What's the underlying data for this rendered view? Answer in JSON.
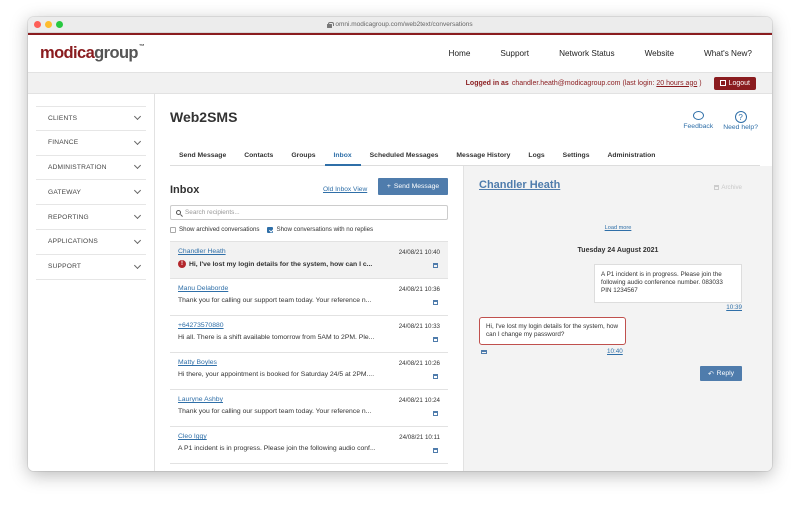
{
  "browser": {
    "url": "omni.modicagroup.com/web2text/conversations"
  },
  "brand": {
    "logo_main": "modica",
    "logo_group": "group",
    "logo_mark": "™",
    "color": "#8a1c1f"
  },
  "topnav": [
    "Home",
    "Support",
    "Network Status",
    "Website",
    "What's New?"
  ],
  "login": {
    "prefix": "Logged in as",
    "user": "chandler.heath@modicagroup.com",
    "last_login_prefix": "(last login:",
    "last_login_value": "20 hours ago",
    "last_login_suffix": ")",
    "logout": "Logout"
  },
  "sidebar": [
    "CLIENTS",
    "FINANCE",
    "ADMINISTRATION",
    "GATEWAY",
    "REPORTING",
    "APPLICATIONS",
    "SUPPORT"
  ],
  "page": {
    "title": "Web2SMS",
    "feedback": "Feedback",
    "help": "Need help?",
    "help_glyph": "?"
  },
  "tabs": [
    "Send Message",
    "Contacts",
    "Groups",
    "Inbox",
    "Scheduled Messages",
    "Message History",
    "Logs",
    "Settings",
    "Administration"
  ],
  "active_tab": "Inbox",
  "inbox": {
    "title": "Inbox",
    "old_view": "Old Inbox View",
    "send_button": "Send Message",
    "search_placeholder": "Search recipients...",
    "show_archived": "Show archived conversations",
    "show_no_replies": "Show conversations with no replies",
    "show_archived_checked": false,
    "show_no_replies_checked": true,
    "conversations": [
      {
        "name": "Chandler Heath",
        "time": "24/08/21 10:40",
        "message": "Hi, I've lost my login details for the system, how can I c...",
        "unread": true
      },
      {
        "name": "Manu Delaborde",
        "time": "24/08/21 10:36",
        "message": "Thank you for calling our support team today. Your reference n...",
        "unread": false
      },
      {
        "name": "+64273570880",
        "time": "24/08/21 10:33",
        "message": "Hi all. There is a shift available tomorrow from 5AM to 2PM. Ple...",
        "unread": false
      },
      {
        "name": "Matty Boyles",
        "time": "24/08/21 10:26",
        "message": "Hi there, your appointment is booked for Saturday 24/5 at 2PM....",
        "unread": false
      },
      {
        "name": "Lauryne Ashby",
        "time": "24/08/21 10:24",
        "message": "Thank you for calling our support team today. Your reference n...",
        "unread": false
      },
      {
        "name": "Cleo Iggy",
        "time": "24/08/21 10:11",
        "message": "A P1 incident is in progress. Please join the following audio conf...",
        "unread": false
      }
    ]
  },
  "conversation": {
    "name": "Chandler Heath",
    "archive": "Archive",
    "load_more": "Load more",
    "date": "Tuesday 24 August 2021",
    "outgoing": {
      "text": "A P1 incident is in progress. Please join the following audio conference number. 083033 PIN 1234567",
      "time": "10:39"
    },
    "incoming": {
      "text": "Hi, I've lost my login details for the system, how can I change my password?",
      "time": "10:40"
    },
    "reply": "Reply"
  }
}
